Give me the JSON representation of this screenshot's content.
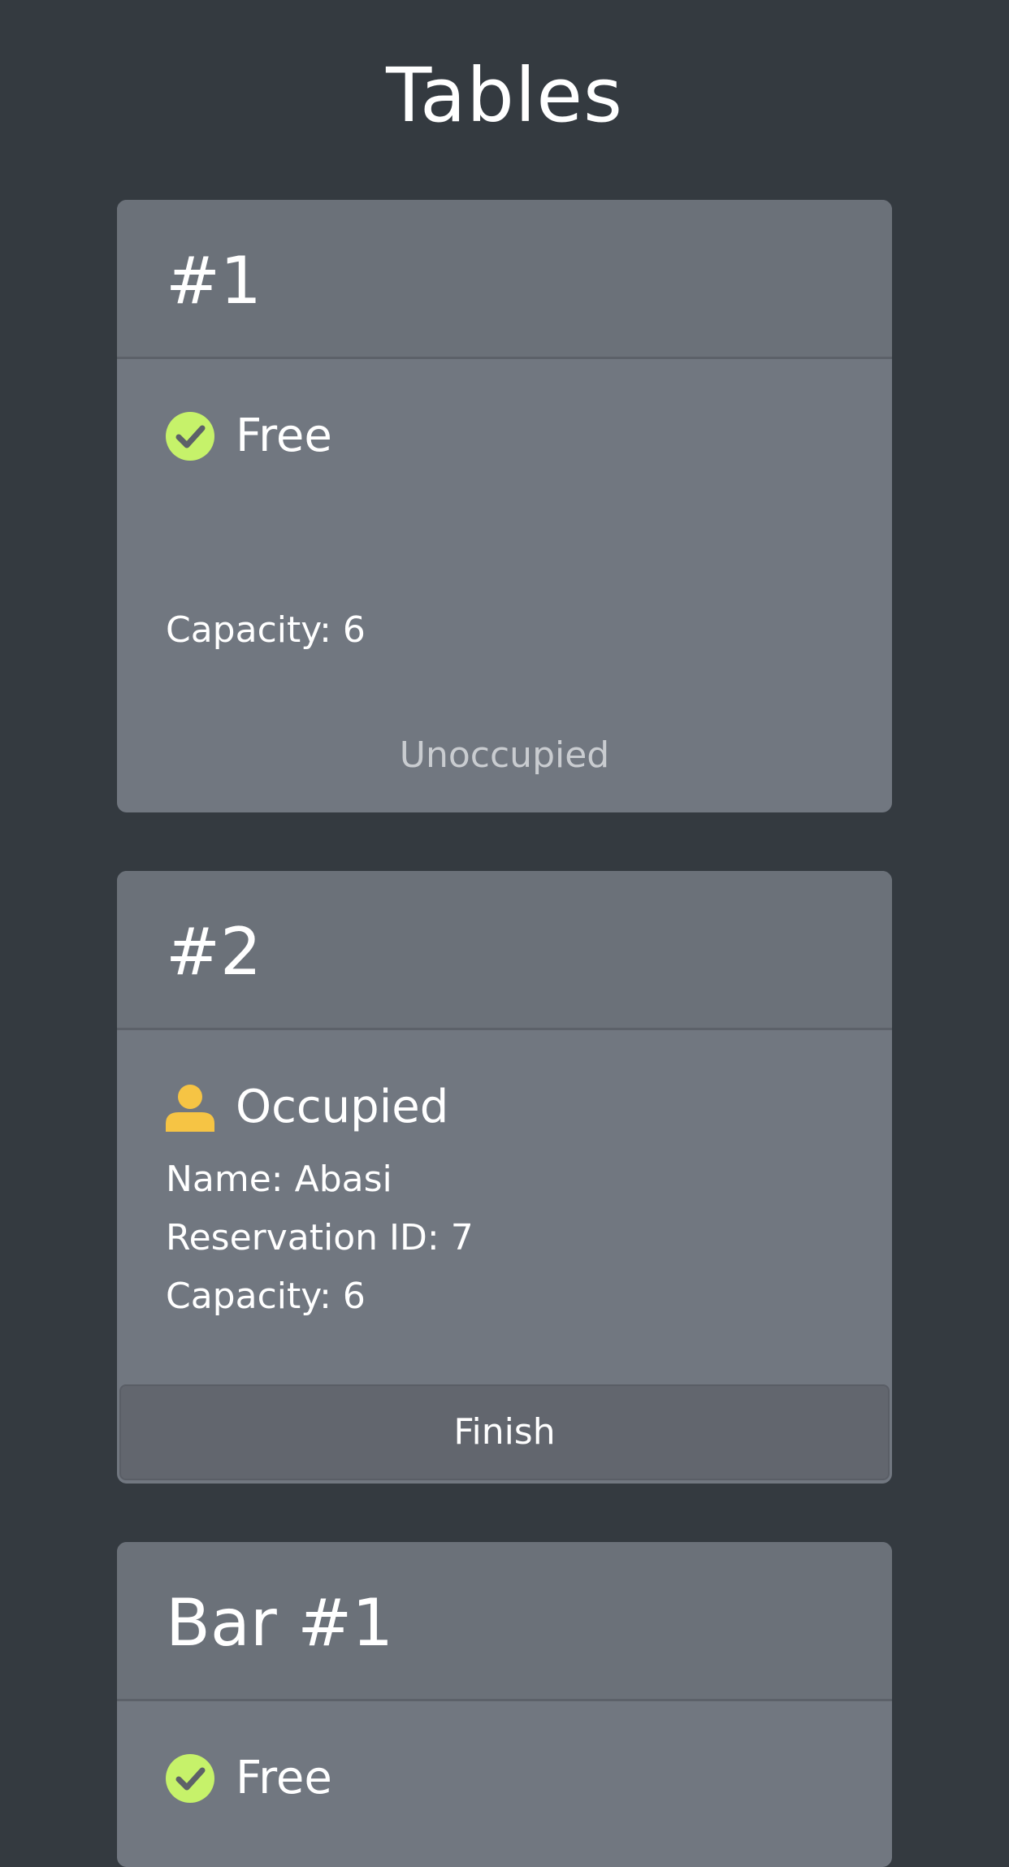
{
  "page": {
    "title": "Tables"
  },
  "colors": {
    "background": "#343a40",
    "card": "#717780",
    "card_header": "#6b7179",
    "free": "#c6f26a",
    "occupied": "#f6c444"
  },
  "tables": [
    {
      "name": "#1",
      "status": {
        "label": "Free",
        "icon": "check-circle-icon"
      },
      "capacity": "Capacity: 6",
      "footer": "Unoccupied"
    },
    {
      "name": "#2",
      "status": {
        "label": "Occupied",
        "icon": "person-icon"
      },
      "guest_name": "Name: Abasi",
      "reservation_id": "Reservation ID: 7",
      "capacity": "Capacity: 6",
      "action": "Finish"
    },
    {
      "name": "Bar #1",
      "status": {
        "label": "Free",
        "icon": "check-circle-icon"
      }
    }
  ]
}
